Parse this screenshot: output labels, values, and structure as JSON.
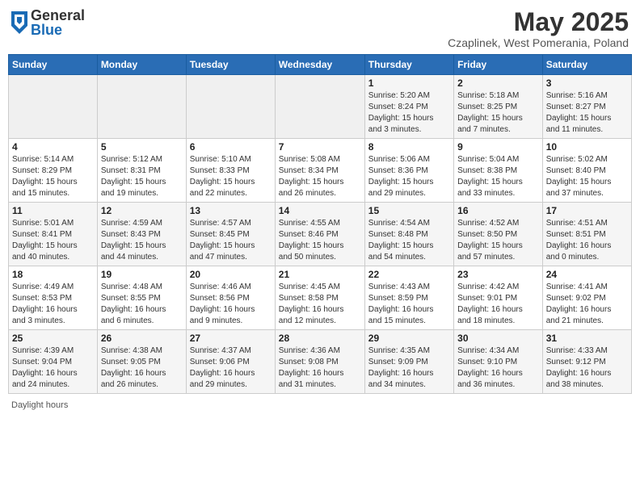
{
  "header": {
    "logo_general": "General",
    "logo_blue": "Blue",
    "month_title": "May 2025",
    "location": "Czaplinek, West Pomerania, Poland"
  },
  "days_of_week": [
    "Sunday",
    "Monday",
    "Tuesday",
    "Wednesday",
    "Thursday",
    "Friday",
    "Saturday"
  ],
  "weeks": [
    [
      {
        "day": "",
        "info": ""
      },
      {
        "day": "",
        "info": ""
      },
      {
        "day": "",
        "info": ""
      },
      {
        "day": "",
        "info": ""
      },
      {
        "day": "1",
        "info": "Sunrise: 5:20 AM\nSunset: 8:24 PM\nDaylight: 15 hours\nand 3 minutes."
      },
      {
        "day": "2",
        "info": "Sunrise: 5:18 AM\nSunset: 8:25 PM\nDaylight: 15 hours\nand 7 minutes."
      },
      {
        "day": "3",
        "info": "Sunrise: 5:16 AM\nSunset: 8:27 PM\nDaylight: 15 hours\nand 11 minutes."
      }
    ],
    [
      {
        "day": "4",
        "info": "Sunrise: 5:14 AM\nSunset: 8:29 PM\nDaylight: 15 hours\nand 15 minutes."
      },
      {
        "day": "5",
        "info": "Sunrise: 5:12 AM\nSunset: 8:31 PM\nDaylight: 15 hours\nand 19 minutes."
      },
      {
        "day": "6",
        "info": "Sunrise: 5:10 AM\nSunset: 8:33 PM\nDaylight: 15 hours\nand 22 minutes."
      },
      {
        "day": "7",
        "info": "Sunrise: 5:08 AM\nSunset: 8:34 PM\nDaylight: 15 hours\nand 26 minutes."
      },
      {
        "day": "8",
        "info": "Sunrise: 5:06 AM\nSunset: 8:36 PM\nDaylight: 15 hours\nand 29 minutes."
      },
      {
        "day": "9",
        "info": "Sunrise: 5:04 AM\nSunset: 8:38 PM\nDaylight: 15 hours\nand 33 minutes."
      },
      {
        "day": "10",
        "info": "Sunrise: 5:02 AM\nSunset: 8:40 PM\nDaylight: 15 hours\nand 37 minutes."
      }
    ],
    [
      {
        "day": "11",
        "info": "Sunrise: 5:01 AM\nSunset: 8:41 PM\nDaylight: 15 hours\nand 40 minutes."
      },
      {
        "day": "12",
        "info": "Sunrise: 4:59 AM\nSunset: 8:43 PM\nDaylight: 15 hours\nand 44 minutes."
      },
      {
        "day": "13",
        "info": "Sunrise: 4:57 AM\nSunset: 8:45 PM\nDaylight: 15 hours\nand 47 minutes."
      },
      {
        "day": "14",
        "info": "Sunrise: 4:55 AM\nSunset: 8:46 PM\nDaylight: 15 hours\nand 50 minutes."
      },
      {
        "day": "15",
        "info": "Sunrise: 4:54 AM\nSunset: 8:48 PM\nDaylight: 15 hours\nand 54 minutes."
      },
      {
        "day": "16",
        "info": "Sunrise: 4:52 AM\nSunset: 8:50 PM\nDaylight: 15 hours\nand 57 minutes."
      },
      {
        "day": "17",
        "info": "Sunrise: 4:51 AM\nSunset: 8:51 PM\nDaylight: 16 hours\nand 0 minutes."
      }
    ],
    [
      {
        "day": "18",
        "info": "Sunrise: 4:49 AM\nSunset: 8:53 PM\nDaylight: 16 hours\nand 3 minutes."
      },
      {
        "day": "19",
        "info": "Sunrise: 4:48 AM\nSunset: 8:55 PM\nDaylight: 16 hours\nand 6 minutes."
      },
      {
        "day": "20",
        "info": "Sunrise: 4:46 AM\nSunset: 8:56 PM\nDaylight: 16 hours\nand 9 minutes."
      },
      {
        "day": "21",
        "info": "Sunrise: 4:45 AM\nSunset: 8:58 PM\nDaylight: 16 hours\nand 12 minutes."
      },
      {
        "day": "22",
        "info": "Sunrise: 4:43 AM\nSunset: 8:59 PM\nDaylight: 16 hours\nand 15 minutes."
      },
      {
        "day": "23",
        "info": "Sunrise: 4:42 AM\nSunset: 9:01 PM\nDaylight: 16 hours\nand 18 minutes."
      },
      {
        "day": "24",
        "info": "Sunrise: 4:41 AM\nSunset: 9:02 PM\nDaylight: 16 hours\nand 21 minutes."
      }
    ],
    [
      {
        "day": "25",
        "info": "Sunrise: 4:39 AM\nSunset: 9:04 PM\nDaylight: 16 hours\nand 24 minutes."
      },
      {
        "day": "26",
        "info": "Sunrise: 4:38 AM\nSunset: 9:05 PM\nDaylight: 16 hours\nand 26 minutes."
      },
      {
        "day": "27",
        "info": "Sunrise: 4:37 AM\nSunset: 9:06 PM\nDaylight: 16 hours\nand 29 minutes."
      },
      {
        "day": "28",
        "info": "Sunrise: 4:36 AM\nSunset: 9:08 PM\nDaylight: 16 hours\nand 31 minutes."
      },
      {
        "day": "29",
        "info": "Sunrise: 4:35 AM\nSunset: 9:09 PM\nDaylight: 16 hours\nand 34 minutes."
      },
      {
        "day": "30",
        "info": "Sunrise: 4:34 AM\nSunset: 9:10 PM\nDaylight: 16 hours\nand 36 minutes."
      },
      {
        "day": "31",
        "info": "Sunrise: 4:33 AM\nSunset: 9:12 PM\nDaylight: 16 hours\nand 38 minutes."
      }
    ]
  ],
  "footer": {
    "daylight_label": "Daylight hours"
  }
}
